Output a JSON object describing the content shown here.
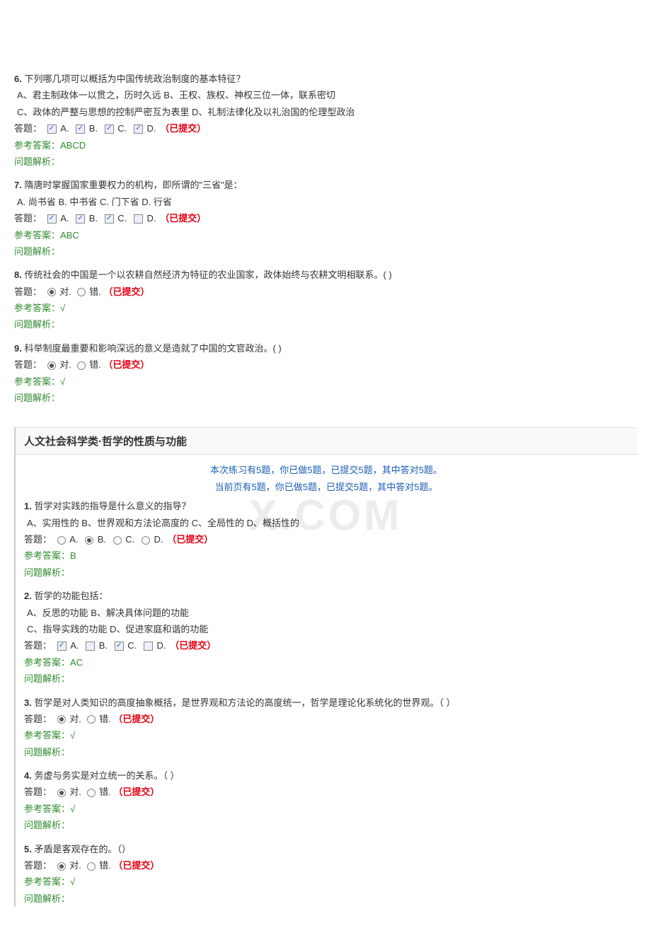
{
  "labels": {
    "answer": "答题：",
    "submitted": "（已提交）",
    "refAnswer": "参考答案：",
    "analysis": "问题解析：",
    "correct_true": "对",
    "correct_false": "错",
    "correct_check": "√"
  },
  "section1": {
    "questions": [
      {
        "num": "6.",
        "text": "下列哪几项可以概括为中国传统政治制度的基本特征？",
        "options": "A、君主制政体一以贯之，历时久远  B、王权、族权、神权三位一体，联系密切\n C、政体的严整与思想的控制严密互为表里  D、礼制法律化及以礼治国的伦理型政治",
        "type": "multi",
        "selected": [
          "A",
          "B",
          "C",
          "D"
        ],
        "ref": "ABCD"
      },
      {
        "num": "7.",
        "text": "隋唐时掌握国家重要权力的机构，即所谓的\"三省\"是：",
        "options": "A. 尚书省  B. 中书省  C. 门下省  D. 行省",
        "type": "multi",
        "selected": [
          "A",
          "B",
          "C"
        ],
        "ref": "ABC"
      },
      {
        "num": "8.",
        "text": "传统社会的中国是一个以农耕自然经济为特征的农业国家，政体始终与农耕文明相联系。( )",
        "options": "",
        "type": "tf",
        "selected": "true",
        "ref": "√"
      },
      {
        "num": "9.",
        "text": "科举制度最重要和影响深远的意义是造就了中国的文官政治。( )",
        "options": "",
        "type": "tf",
        "selected": "true",
        "ref": "√"
      }
    ]
  },
  "section2": {
    "title": "人文社会科学类·哲学的性质与功能",
    "summary1": "本次练习有5题，你已做5题，已提交5题，其中答对5题。",
    "summary2": "当前页有5题，你已做5题，已提交5题，其中答对5题。",
    "questions": [
      {
        "num": "1.",
        "text": "哲学对实践的指导是什么意义的指导？",
        "options": "A、实用性的 B、世界观和方法论高度的 C、全局性的 D、概括性的",
        "type": "single",
        "selected": "B",
        "ref": "B"
      },
      {
        "num": "2.",
        "text": "哲学的功能包括：",
        "options": "A、反思的功能  B、解决具体问题的功能\n C、指导实践的功能  D、促进家庭和谐的功能",
        "type": "multi",
        "selected": [
          "A",
          "C"
        ],
        "ref": "AC"
      },
      {
        "num": "3.",
        "text": "哲学是对人类知识的高度抽象概括，是世界观和方法论的高度统一，哲学是理论化系统化的世界观。（  ）",
        "options": "",
        "type": "tf",
        "selected": "true",
        "ref": "√"
      },
      {
        "num": "4.",
        "text": "务虚与务实是对立统一的关系。（  ）",
        "options": "",
        "type": "tf",
        "selected": "true",
        "ref": "√"
      },
      {
        "num": "5.",
        "text": "矛盾是客观存在的。（）",
        "options": "",
        "type": "tf",
        "selected": "true",
        "ref": "√"
      }
    ]
  },
  "watermark": "X.COM"
}
